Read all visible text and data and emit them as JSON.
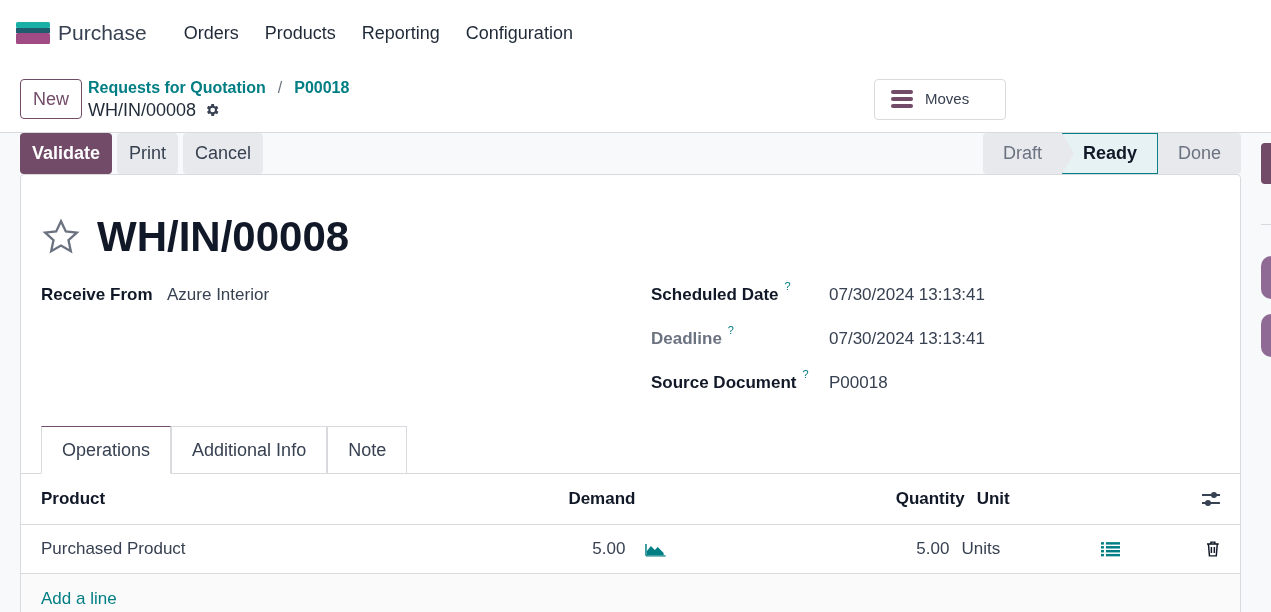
{
  "navbar": {
    "app": "Purchase",
    "menu": [
      "Orders",
      "Products",
      "Reporting",
      "Configuration"
    ]
  },
  "control_panel": {
    "new_button": "New",
    "breadcrumbs": [
      "Requests for Quotation",
      "P00018"
    ],
    "separator": "/",
    "record": "WH/IN/00008",
    "moves_button": "Moves"
  },
  "actions": [
    {
      "label": "Validate",
      "primary": true
    },
    {
      "label": "Print",
      "primary": false
    },
    {
      "label": "Cancel",
      "primary": false
    }
  ],
  "stages": [
    {
      "label": "Draft",
      "selected": false
    },
    {
      "label": "Ready",
      "selected": true
    },
    {
      "label": "Done",
      "selected": false
    }
  ],
  "form": {
    "starred": false,
    "title": "WH/IN/00008",
    "left_fields": [
      {
        "label": "Receive From",
        "value": "Azure Interior",
        "muted": false
      }
    ],
    "right_fields": [
      {
        "label": "Scheduled Date",
        "help": "?",
        "value": "07/30/2024 13:13:41",
        "muted": false
      },
      {
        "label": "Deadline",
        "help": "?",
        "value": "07/30/2024 13:13:41",
        "muted": true
      },
      {
        "label": "Source Document",
        "help": "?",
        "value": "P00018",
        "muted": false
      }
    ],
    "tabs": [
      {
        "label": "Operations",
        "selected": true
      },
      {
        "label": "Additional Info",
        "selected": false
      },
      {
        "label": "Note",
        "selected": false
      }
    ],
    "table": {
      "columns": [
        "Product",
        "Demand",
        "Quantity",
        "Unit"
      ],
      "rows": [
        {
          "product": "Purchased Product",
          "demand": "5.00",
          "quantity": "5.00",
          "unit": "Units"
        }
      ],
      "add_line": "Add a line"
    }
  }
}
